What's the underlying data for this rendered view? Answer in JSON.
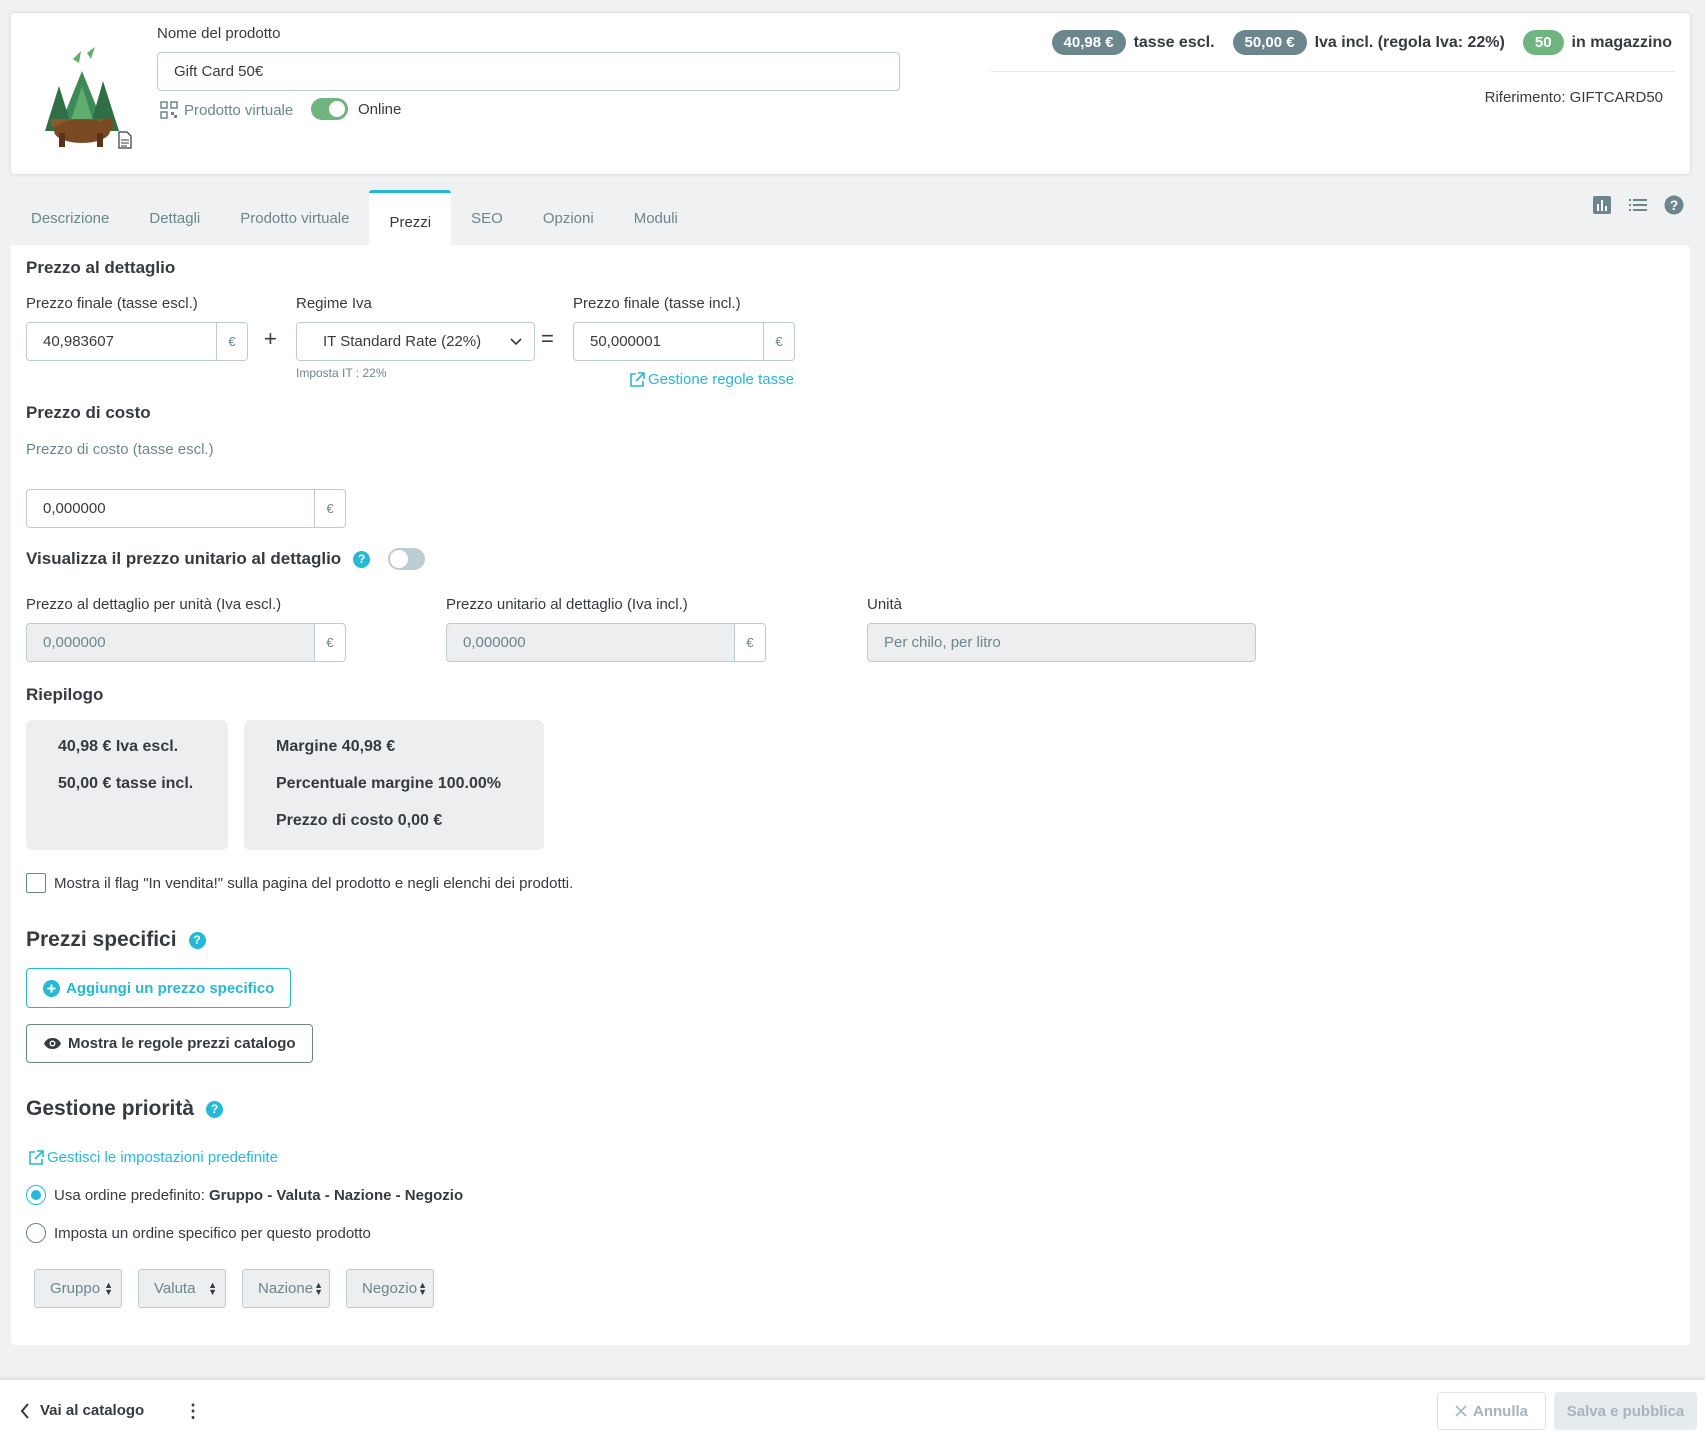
{
  "header": {
    "name_label": "Nome del prodotto",
    "name_value": "Gift Card 50€",
    "virtual_label": "Prodotto virtuale",
    "online_label": "Online",
    "online_enabled": true,
    "price_excl": "40,98 €",
    "price_excl_label": "tasse escl.",
    "price_incl": "50,00 €",
    "price_incl_label": "Iva incl. (regola Iva: 22%)",
    "stock": "50",
    "stock_label": "in magazzino",
    "reference": "Riferimento: GIFTCARD50"
  },
  "tabs": [
    {
      "label": "Descrizione"
    },
    {
      "label": "Dettagli"
    },
    {
      "label": "Prodotto virtuale"
    },
    {
      "label": "Prezzi",
      "active": true
    },
    {
      "label": "SEO"
    },
    {
      "label": "Opzioni"
    },
    {
      "label": "Moduli"
    }
  ],
  "retail": {
    "title": "Prezzo al dettaglio",
    "excl_label": "Prezzo finale (tasse escl.)",
    "excl_value": "40,983607",
    "currency": "€",
    "tax_label": "Regime Iva",
    "tax_value": "IT Standard Rate (22%)",
    "tax_note": "Imposta IT : 22%",
    "incl_label": "Prezzo finale (tasse incl.)",
    "incl_value": "50,000001",
    "tax_rules_link": "Gestione regole tasse",
    "plus": "+",
    "equals": "="
  },
  "cost": {
    "title": "Prezzo di costo",
    "label": "Prezzo di costo (tasse escl.)",
    "value": "0,000000"
  },
  "unit_price": {
    "title": "Visualizza il prezzo unitario al dettaglio",
    "enabled": false,
    "excl_label": "Prezzo al dettaglio per unità (Iva escl.)",
    "excl_value": "0,000000",
    "incl_label": "Prezzo unitario al dettaglio (Iva incl.)",
    "incl_value": "0,000000",
    "unit_label": "Unità",
    "unit_placeholder": "Per chilo, per litro"
  },
  "summary": {
    "title": "Riepilogo",
    "box1": [
      "40,98 € Iva escl.",
      "50,00 € tasse incl."
    ],
    "box2": [
      "Margine 40,98 €",
      "Percentuale margine 100.00%",
      "Prezzo di costo 0,00 €"
    ]
  },
  "on_sale_checkbox": "Mostra il flag \"In vendita!\" sulla pagina del prodotto e negli elenchi dei prodotti.",
  "specific_prices": {
    "title": "Prezzi specifici",
    "add_button": "Aggiungi un prezzo specifico",
    "catalog_rules_button": "Mostra le regole prezzi catalogo"
  },
  "priority": {
    "title": "Gestione priorità",
    "defaults_link": "Gestisci le impostazioni predefinite",
    "option_default_label": "Usa ordine predefinito:",
    "option_default_order": "Gruppo - Valuta - Nazione - Negozio",
    "option_specific_label": "Imposta un ordine specifico per questo prodotto",
    "selects": [
      "Gruppo",
      "Valuta",
      "Nazione",
      "Negozio"
    ]
  },
  "footer": {
    "back_label": "Vai al catalogo",
    "cancel_label": "Annulla",
    "save_label": "Salva e pubblica"
  },
  "colors": {
    "accent": "#25b9d7",
    "success": "#70b580",
    "badge": "#6c868e"
  }
}
